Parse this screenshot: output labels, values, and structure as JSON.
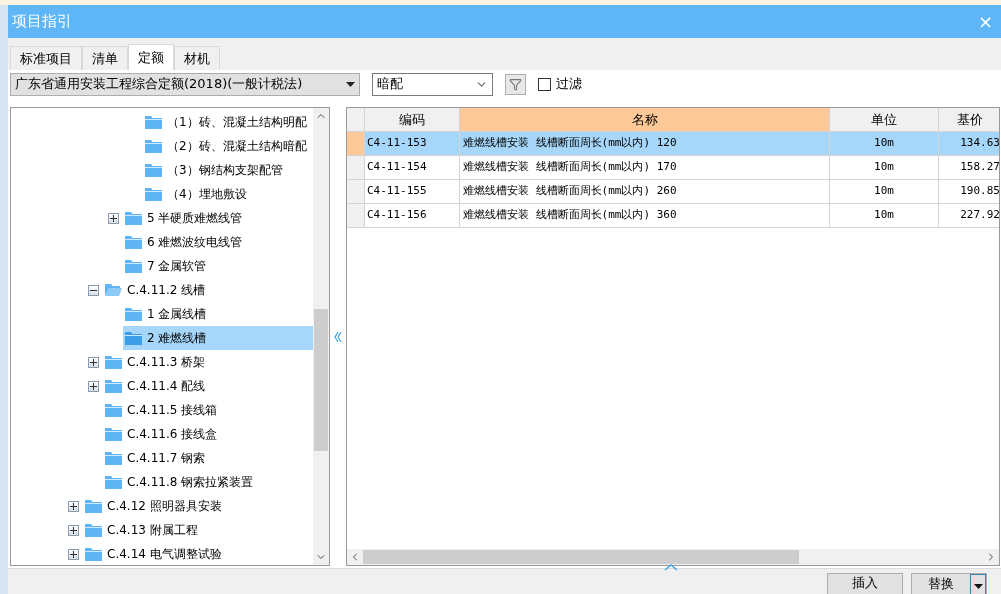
{
  "window": {
    "title": "项目指引",
    "close": "×"
  },
  "tabs": [
    {
      "label": "标准项目",
      "selected": false
    },
    {
      "label": "清单",
      "selected": false
    },
    {
      "label": "定额",
      "selected": true
    },
    {
      "label": "材机",
      "selected": false
    }
  ],
  "library_select": {
    "value": "广东省通用安装工程综合定额(2018)(一般计税法)"
  },
  "filter_select": {
    "value": "暗配"
  },
  "filter_checkbox": {
    "label": "过滤",
    "checked": false
  },
  "tree": [
    {
      "children": [
        {
          "children": [
            {
              "children": [
                {
                  "label": "（1）砖、混凝土结构明配",
                  "selected": false
                },
                {
                  "label": "（2）砖、混凝土结构暗配",
                  "selected": false
                },
                {
                  "label": "（3）钢结构支架配管",
                  "selected": false
                },
                {
                  "label": "（4）埋地敷设",
                  "selected": false
                }
              ]
            },
            {
              "label": "5 半硬质难燃线管",
              "selected": false,
              "expanded": false
            },
            {
              "label": "6 难燃波纹电线管",
              "selected": false
            },
            {
              "label": "7 金属软管",
              "selected": false
            }
          ]
        },
        {
          "label": "C.4.11.2 线槽",
          "selected": false,
          "expanded": true,
          "children": [
            {
              "label": "1 金属线槽",
              "selected": false
            },
            {
              "label": "2 难燃线槽",
              "selected": true
            }
          ]
        },
        {
          "label": "C.4.11.3 桥架",
          "selected": false,
          "expanded": false
        },
        {
          "label": "C.4.11.4 配线",
          "selected": false,
          "expanded": false
        },
        {
          "label": "C.4.11.5 接线箱",
          "selected": false
        },
        {
          "label": "C.4.11.6 接线盒",
          "selected": false
        },
        {
          "label": "C.4.11.7 钢索",
          "selected": false
        },
        {
          "label": "C.4.11.8 钢索拉紧装置",
          "selected": false
        }
      ]
    },
    {
      "label": "C.4.12 照明器具安装",
      "selected": false,
      "expanded": false
    },
    {
      "label": "C.4.13 附属工程",
      "selected": false,
      "expanded": false
    },
    {
      "label": "C.4.14 电气调整试验",
      "selected": false,
      "expanded": false
    }
  ],
  "table": {
    "columns": [
      {
        "label": "编码",
        "selected": false
      },
      {
        "label": "名称",
        "selected": true
      },
      {
        "label": "单位",
        "selected": false
      },
      {
        "label": "基价",
        "selected": false
      }
    ],
    "rows": [
      {
        "selected": true,
        "cells": [
          "C4-11-153",
          "难燃线槽安装 线槽断面周长(mm以内) 120",
          "10m",
          "134.63"
        ]
      },
      {
        "selected": false,
        "cells": [
          "C4-11-154",
          "难燃线槽安装 线槽断面周长(mm以内) 170",
          "10m",
          "158.27"
        ]
      },
      {
        "selected": false,
        "cells": [
          "C4-11-155",
          "难燃线槽安装 线槽断面周长(mm以内) 260",
          "10m",
          "190.85"
        ]
      },
      {
        "selected": false,
        "cells": [
          "C4-11-156",
          "难燃线槽安装 线槽断面周长(mm以内) 360",
          "10m",
          "227.92"
        ]
      }
    ]
  },
  "buttons": [
    {
      "label": "插入",
      "kind": "plain"
    },
    {
      "label": "替换",
      "kind": "split"
    }
  ]
}
